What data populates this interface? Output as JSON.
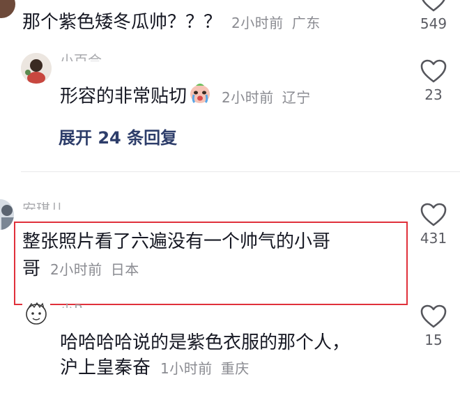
{
  "comments": [
    {
      "text": "那个紫色矮冬瓜帅？？？",
      "time": "2小时前",
      "location": "广东",
      "likes": "549"
    },
    {
      "username": "小百合",
      "text": "形容的非常贴切",
      "emoji": "crying-face-emoji",
      "time": "2小时前",
      "location": "辽宁",
      "likes": "23",
      "expand_label": "展开 24 条回复"
    },
    {
      "username": "安琪儿",
      "text_line1": "整张照片看了六遍没有一个帅气的小哥",
      "text_line2": "哥",
      "time": "2小时前",
      "location": "日本",
      "likes": "431"
    },
    {
      "username": "小P",
      "text_line1": "哈哈哈哈说的是紫色衣服的那个人，",
      "text_line2": "沪上皇秦奋",
      "time": "1小时前",
      "location": "重庆",
      "likes": "15"
    }
  ],
  "colors": {
    "highlight": "#e0303a",
    "expand_link": "#2d3d6a",
    "meta": "#8a8b91"
  }
}
